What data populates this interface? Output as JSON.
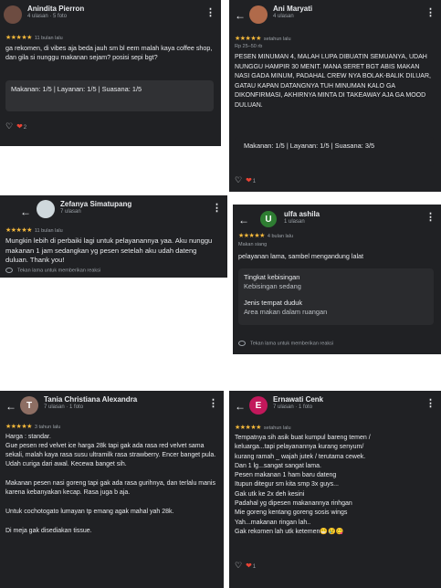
{
  "reviews": {
    "r1": {
      "name": "Anindita Pierron",
      "sub": "4 ulasan · 5 foto",
      "avatar": "",
      "stars": "★★★★★",
      "when": "11 bulan lalu",
      "text": "ga rekomen, di vibes aja beda jauh sm bl eem malah kaya coffee shop, dan gila si nunggu makanan sejam? posisi sepi bgt?",
      "ratings": "Makanan: 1/5 | Layanan: 1/5 | Suasana: 1/5",
      "reactions": "2"
    },
    "r2": {
      "name": "Ani Maryati",
      "sub": "4 ulasan",
      "avatar": "",
      "stars": "★★★★★",
      "when": "setahun lalu",
      "price": "Rp 25–50 rb",
      "text": "PESEN MINUMAN 4, MALAH LUPA DIBUATIN SEMUANYA, UDAH NUNGGU HAMPIR 30 MENIT. MANA SERET BGT ABIS MAKAN NASI GADA MINUM, PADAHAL CREW NYA BOLAK-BALIK DILUAR, GATAU KAPAN DATANGNYA TUH MINUMAN KALO GA DIKONFIRMASI, AKHIRNYA MINTA DI TAKEAWAY AJA GA MOOD DULUAN.",
      "ratings": "Makanan: 1/5 | Layanan: 1/5 | Suasana: 3/5",
      "reactions": "1"
    },
    "r3": {
      "name": "Zefanya Simatupang",
      "sub": "7 ulasan",
      "avatar": "",
      "stars": "★★★★★",
      "when": "11 bulan lalu",
      "text": "Mungkin lebih di perbaiki lagi untuk pelayanannya yaa. Aku nunggu makanan 1 jam sedangkan yg pesen setelah aku udah dateng duluan. Thank you!",
      "hint": "Tekan lama untuk memberikan reaksi"
    },
    "r4": {
      "name": "ulfa ashila",
      "sub": "1 ulasan",
      "avatar": "U",
      "stars": "★★★★★",
      "when": "4 bulan lalu",
      "meal": "Makan siang",
      "text": "pelayanan lama, sambel mengandung lalat",
      "noise_label": "Tingkat kebisingan",
      "noise_value": "Kebisingan sedang",
      "seat_label": "Jenis tempat duduk",
      "seat_value": "Area makan dalam ruangan",
      "hint": "Tekan lama untuk memberikan reaksi"
    },
    "r5": {
      "name": "Tania Christiana Alexandra",
      "sub": "7 ulasan · 1 foto",
      "avatar": "T",
      "stars": "★★★★★",
      "when": "3 tahun lalu",
      "p1": "Harga : standar.",
      "p2": "Gue pesen red velvet ice harga 28k tapi gak ada rasa red velvet sama sekali, malah kaya rasa susu ultramilk rasa strawberry. Encer banget pula. Udah curiga dari awal. Kecewa banget sih.",
      "p3": "Makanan pesen nasi goreng tapi gak ada rasa gurihnya, dan terlalu manis karena kebanyakan kecap. Rasa juga b aja.",
      "p4": "Untuk cochotogato lumayan tp emang agak mahal yah 28k.",
      "p5": "Di meja gak disediakan tissue."
    },
    "r6": {
      "name": "Ernawati Cenk",
      "sub": "7 ulasan · 1 foto",
      "avatar": "E",
      "stars": "★★★★★",
      "when": "setahun lalu",
      "lines": [
        "Tempatnya sih asik buat kumpul bareng temen /",
        "keluarga...tapi pelayanannya kurang senyum/",
        "kurang ramah _ wajah jutek / terutama cewek.",
        "Dan 1 lg...sangat sangat lama.",
        "Pesen makanan 1 ham baru dateng",
        "Itupun ditegur sm kita smp 3x guys...",
        "Gak utk ke 2x deh kesini",
        "Padahal yg dipesen makanannya rinhgan",
        "Mie goreng kentang goreng sosis wings",
        "Yah...makanan ringan lah..",
        "Gak rekomen lah utk ketemen😁😢😋"
      ],
      "reactions": "1"
    }
  },
  "colors": {
    "panel": "#202124",
    "star": "#f6b93b",
    "heart": "#ea4335",
    "avatar_t": "#8d6e63",
    "avatar_e": "#c2185b",
    "avatar_u": "#2e7d32"
  }
}
